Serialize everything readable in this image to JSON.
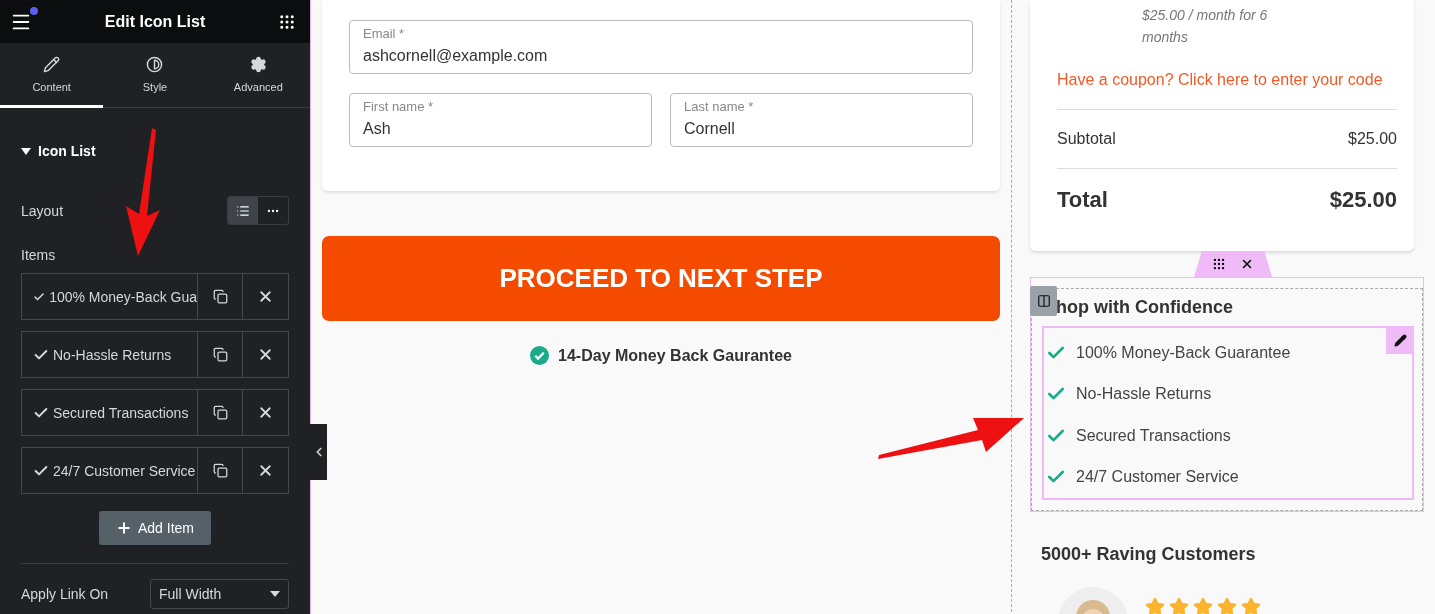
{
  "editor": {
    "title": "Edit Icon List",
    "tabs": [
      {
        "label": "Content",
        "selected": true
      },
      {
        "label": "Style",
        "selected": false
      },
      {
        "label": "Advanced",
        "selected": false
      }
    ],
    "section": {
      "title": "Icon List",
      "expanded": true
    },
    "layout": {
      "label": "Layout",
      "options": [
        {
          "selected": true
        },
        {
          "selected": false
        }
      ]
    },
    "items_label": "Items",
    "items": [
      {
        "text": "100% Money-Back Gua"
      },
      {
        "text": "No-Hassle Returns"
      },
      {
        "text": "Secured Transactions"
      },
      {
        "text": "24/7 Customer Service"
      }
    ],
    "add_button": "Add Item",
    "apply_link": {
      "label": "Apply Link On",
      "value": "Full Width"
    }
  },
  "form": {
    "fields": [
      {
        "label": "Email *",
        "value": "ashcornell@example.com"
      },
      {
        "label": "First name *",
        "value": "Ash"
      },
      {
        "label": "Last name *",
        "value": "Cornell"
      }
    ],
    "submit": "PROCEED TO NEXT STEP",
    "guarantee": "14-Day Money Back Gaurantee"
  },
  "summary": {
    "price_note": "$25.00 / month for 6 months",
    "coupon": "Have a coupon? Click here to enter your code",
    "subtotal": {
      "label": "Subtotal",
      "value": "$25.00"
    },
    "total": {
      "label": "Total",
      "value": "$25.00"
    }
  },
  "confidence": {
    "title": "hop with Confidence",
    "items": [
      {
        "text": "100% Money-Back Guarantee"
      },
      {
        "text": "No-Hassle Returns"
      },
      {
        "text": "Secured Transactions"
      },
      {
        "text": "24/7 Customer Service"
      }
    ]
  },
  "reviews": {
    "title": "5000+ Raving Customers",
    "stars": 5
  }
}
